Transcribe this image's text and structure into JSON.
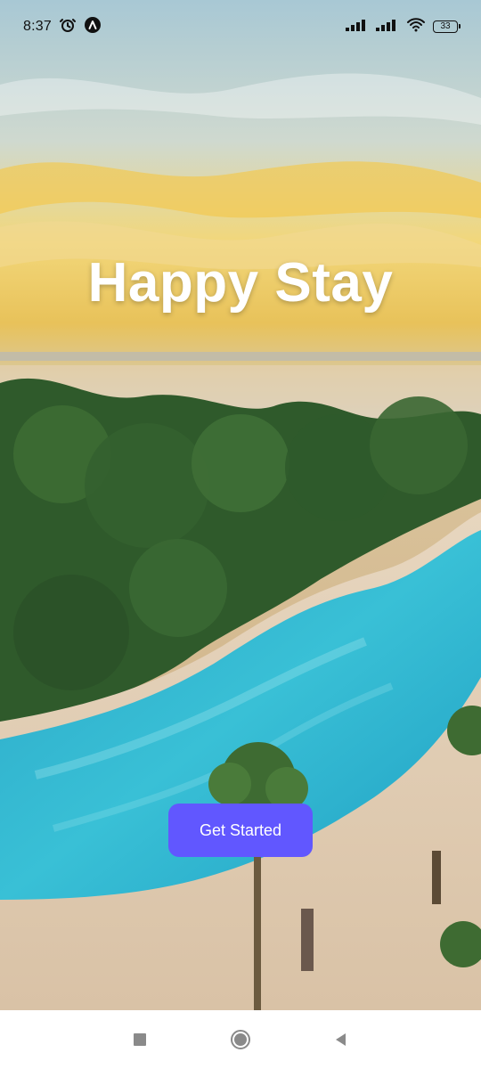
{
  "status_bar": {
    "time": "8:37",
    "battery_level": "33",
    "icons": [
      "alarm-icon",
      "app-notification-icon",
      "signal-icon",
      "signal-icon",
      "wifi-icon",
      "battery-icon"
    ]
  },
  "hero": {
    "title": "Happy Stay",
    "background": "resort-pool-sunset-photo"
  },
  "cta": {
    "label": "Get Started",
    "color": "#6157FF"
  },
  "nav_bar": {
    "icons": [
      "recents-square-icon",
      "home-circle-icon",
      "back-triangle-icon"
    ]
  }
}
